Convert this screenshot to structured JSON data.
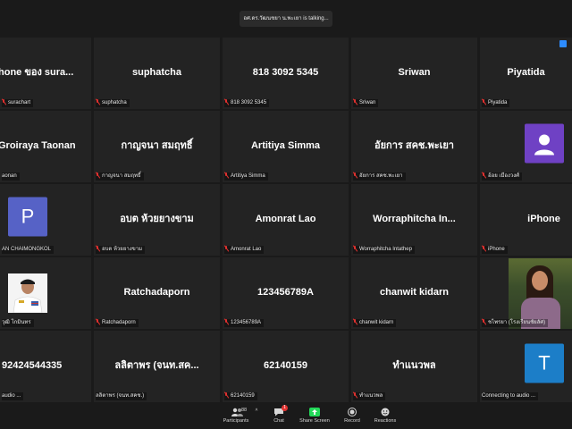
{
  "talking_indicator": "อศ.ดร.วัฒนชยา น.พะเยา is talking...",
  "tiles": [
    {
      "name": "hone ของ sura...",
      "label": "surachart",
      "muted": true
    },
    {
      "name": "suphatcha",
      "label": "suphatcha",
      "muted": true
    },
    {
      "name": "818 3092 5345",
      "label": "818 3092 5345",
      "muted": true
    },
    {
      "name": "Sriwan",
      "label": "Sriwan",
      "muted": true
    },
    {
      "name": "Piyatida",
      "label": "Piyatida",
      "muted": true
    },
    {
      "name": "Groiraya Taonan",
      "label": "aonan",
      "muted": false
    },
    {
      "name": "กาญจนา สมฤทธิ์",
      "label": "กาญจนา สมฤทธิ์",
      "muted": true
    },
    {
      "name": "Artitiya Simma",
      "label": "Artitiya Simma",
      "muted": true
    },
    {
      "name": "อัยการ สคช.พะเยา",
      "label": "อัยการ สคช.พะเยา",
      "muted": true
    },
    {
      "name": "",
      "label": "อ้อย เมืองวงศ์",
      "muted": true
    },
    {
      "name": "",
      "label": "AN CHAIMONGKOL",
      "muted": false
    },
    {
      "name": "อบต ห้วยยางขาม",
      "label": "อบต ห้วยยางขาม",
      "muted": true
    },
    {
      "name": "Amonrat Lao",
      "label": "Amonrat Lao",
      "muted": true
    },
    {
      "name": "Worraphitcha  In...",
      "label": "Worraphitcha Intathep",
      "muted": true
    },
    {
      "name": "iPhone",
      "label": "iPhone",
      "muted": true
    },
    {
      "name": "",
      "label": "วุฒิ โกมินทร",
      "muted": false
    },
    {
      "name": "Ratchadaporn",
      "label": "Ratchadaporn",
      "muted": true
    },
    {
      "name": "123456789A",
      "label": "123456789A",
      "muted": true
    },
    {
      "name": "chanwit kidarn",
      "label": "chanwit kidarn",
      "muted": true
    },
    {
      "name": "",
      "label": "ชไพรยา (โรงเรียนชัยลัศ)",
      "muted": true
    },
    {
      "name": "92424544335",
      "label": "audio ...",
      "muted": false
    },
    {
      "name": "ลลิตาพร (จนท.สค...",
      "label": "ลลิตาพร (จนท.สคช.)",
      "muted": false
    },
    {
      "name": "62140159",
      "label": "62140159",
      "muted": true
    },
    {
      "name": "ทำแนวพล",
      "label": "ทำแนวพล",
      "muted": true
    },
    {
      "name": "",
      "label": "Connecting to audio ...",
      "muted": false
    }
  ],
  "avatars": {
    "p_letter": "P",
    "t_letter": "T",
    "p_color": "#5662c6",
    "t_color": "#1c7ec8",
    "user_color": "#6f41c4"
  },
  "toolbar": {
    "participants_label": "Participants",
    "participants_count": "88",
    "chat_label": "Chat",
    "chat_badge": "1",
    "share_label": "Share Screen",
    "record_label": "Record",
    "reactions_label": "Reactions"
  }
}
